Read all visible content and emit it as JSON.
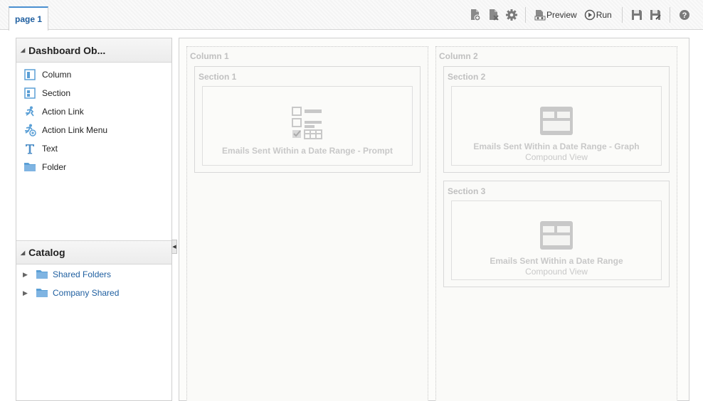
{
  "tabs": [
    {
      "label": "page 1"
    }
  ],
  "toolbar": {
    "preview_label": "Preview",
    "run_label": "Run"
  },
  "dashboard_objects": {
    "title": "Dashboard Ob...",
    "items": [
      {
        "label": "Column",
        "icon": "column-icon"
      },
      {
        "label": "Section",
        "icon": "section-icon"
      },
      {
        "label": "Action Link",
        "icon": "action-link-icon"
      },
      {
        "label": "Action Link Menu",
        "icon": "action-link-menu-icon"
      },
      {
        "label": "Text",
        "icon": "text-icon"
      },
      {
        "label": "Folder",
        "icon": "folder-icon"
      }
    ]
  },
  "catalog": {
    "title": "Catalog",
    "items": [
      {
        "label": "Shared Folders"
      },
      {
        "label": "Company Shared"
      }
    ]
  },
  "canvas": {
    "columns": [
      {
        "label": "Column 1",
        "sections": [
          {
            "label": "Section 1",
            "view": {
              "title": "Emails Sent Within a Date Range - Prompt",
              "subtitle": "",
              "icon": "prompt-icon"
            }
          }
        ]
      },
      {
        "label": "Column 2",
        "sections": [
          {
            "label": "Section 2",
            "view": {
              "title": "Emails Sent Within a Date Range - Graph",
              "subtitle": "Compound View",
              "icon": "compound-view-icon"
            }
          },
          {
            "label": "Section 3",
            "view": {
              "title": "Emails Sent Within a Date Range",
              "subtitle": "Compound View",
              "icon": "compound-view-icon"
            }
          }
        ]
      }
    ]
  },
  "colors": {
    "accent": "#4a8fd0",
    "link": "#1f5fa0",
    "icon_blue": "#5a9fd6",
    "placeholder_gray": "#c8c8c8"
  }
}
